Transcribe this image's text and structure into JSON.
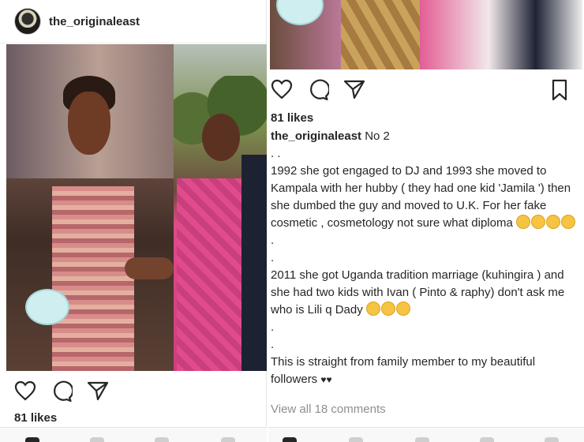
{
  "left_post": {
    "username": "the_originaleast",
    "likes": "81 likes",
    "icons": {
      "avatar": "profile-avatar",
      "like": "heart-icon",
      "comment": "comment-icon",
      "share": "share-icon"
    }
  },
  "right_post": {
    "likes": "81 likes",
    "caption": {
      "username": "the_originaleast",
      "first_line": "No 2",
      "sep1": ". .",
      "para1": "1992 she got engaged to DJ and 1993 she moved to Kampala with her hubby ( they had one kid 'Jamila ') then she dumbed the guy and moved to U.K. For her fake cosmetic , cosmetology not sure what diploma",
      "sep2": ".",
      "sep3": ".",
      "para2": "2011 she got Uganda tradition marriage (kuhingira ) and she had two kids with Ivan ( Pinto & raphy) don't ask me who is Lili q Dady",
      "sep4": ".",
      "sep5": ".",
      "para3": "This is straight from family member to my beautiful followers"
    },
    "view_all_comments": "View all 18 comments",
    "icons": {
      "like": "heart-icon",
      "comment": "comment-icon",
      "share": "share-icon",
      "save": "bookmark-icon",
      "emoji": "grinning-sweat-emoji"
    }
  }
}
